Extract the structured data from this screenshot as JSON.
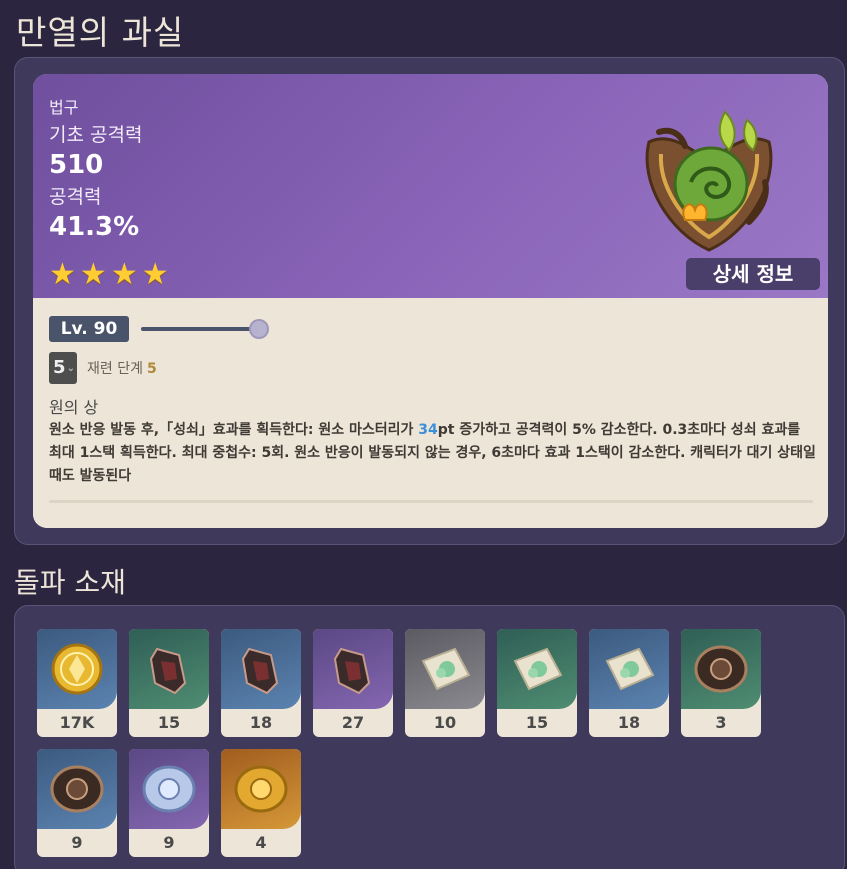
{
  "page_title": "만열의 과실",
  "weapon": {
    "type": "법구",
    "base_atk_label": "기초 공격력",
    "base_atk_value": "510",
    "sub_stat_label": "공격력",
    "sub_stat_value": "41.3%",
    "rarity_stars": 4,
    "star_glyph": "★",
    "detail_button": "상세 정보",
    "level": "Lv. 90",
    "level_progress": 1.0,
    "refinement_value": "5",
    "refinement_label": "재련 단계",
    "refinement_number": "5",
    "passive_name": "원의 상",
    "passive_desc_1": "원소 반응 발동 후,「성쇠」효과를 획득한다: 원소 마스터리가 ",
    "passive_desc_highlight": "34",
    "passive_desc_2": "pt 증가하고 공격력이 5% 감소한다. 0.3초마다 성쇠 효과를 최대 1스택 획득한다. 최대 중첩수: 5회. 원소 반응이 발동되지 않는 경우, 6초마다 효과 1스택이 감소한다. 캐릭터가 대기 상태일 때도 발동된다"
  },
  "materials_title": "돌파 소재",
  "materials": [
    {
      "count": "17K",
      "bg": "blue",
      "icon": "mora-coin-icon"
    },
    {
      "count": "15",
      "bg": "green",
      "icon": "relic-fragment-icon"
    },
    {
      "count": "18",
      "bg": "blue",
      "icon": "relic-fragment-icon"
    },
    {
      "count": "27",
      "bg": "purple",
      "icon": "relic-fragment-icon"
    },
    {
      "count": "10",
      "bg": "gray",
      "icon": "wrapped-herb-icon"
    },
    {
      "count": "15",
      "bg": "green",
      "icon": "wrapped-herb-icon"
    },
    {
      "count": "18",
      "bg": "blue",
      "icon": "wrapped-herb-icon"
    },
    {
      "count": "3",
      "bg": "green",
      "icon": "dark-badge-icon"
    },
    {
      "count": "9",
      "bg": "blue",
      "icon": "dark-badge-icon"
    },
    {
      "count": "9",
      "bg": "purple",
      "icon": "silver-badge-icon"
    },
    {
      "count": "4",
      "bg": "orange",
      "icon": "gold-badge-icon"
    }
  ]
}
